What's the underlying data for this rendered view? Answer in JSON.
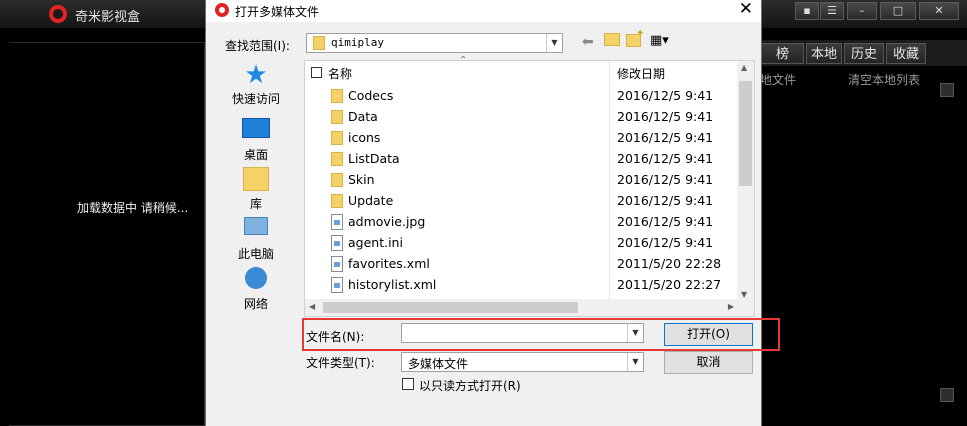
{
  "app": {
    "title": "奇米影视盒",
    "loading_text": "加载数据中 请稍候...",
    "tabs": [
      "榜",
      "本地",
      "历史",
      "收藏"
    ],
    "local_files_link": "地文件",
    "clear_local_link": "清空本地列表"
  },
  "dialog": {
    "title": "打开多媒体文件",
    "lookin_label": "查找范围(I):",
    "lookin_value": "qimiplay",
    "places": [
      "快速访问",
      "桌面",
      "库",
      "此电脑",
      "网络"
    ],
    "columns": {
      "name": "名称",
      "date": "修改日期"
    },
    "files": [
      {
        "name": "Codecs",
        "date": "2016/12/5 9:41",
        "type": "folder"
      },
      {
        "name": "Data",
        "date": "2016/12/5 9:41",
        "type": "folder"
      },
      {
        "name": "icons",
        "date": "2016/12/5 9:41",
        "type": "folder"
      },
      {
        "name": "ListData",
        "date": "2016/12/5 9:41",
        "type": "folder"
      },
      {
        "name": "Skin",
        "date": "2016/12/5 9:41",
        "type": "folder"
      },
      {
        "name": "Update",
        "date": "2016/12/5 9:41",
        "type": "folder"
      },
      {
        "name": "admovie.jpg",
        "date": "2016/12/5 9:41",
        "type": "file"
      },
      {
        "name": "agent.ini",
        "date": "2016/12/5 9:41",
        "type": "file"
      },
      {
        "name": "favorites.xml",
        "date": "2011/5/20 22:28",
        "type": "file"
      },
      {
        "name": "historylist.xml",
        "date": "2011/5/20 22:27",
        "type": "file"
      }
    ],
    "filename_label": "文件名(N):",
    "filename_value": "",
    "filetype_label": "文件类型(T):",
    "filetype_value": "多媒体文件",
    "open_button": "打开(O)",
    "cancel_button": "取消",
    "readonly_label": "以只读方式打开(R)"
  },
  "colors": {
    "highlight": "#e53935",
    "accent": "#0078d7",
    "logo": "#e02424"
  }
}
